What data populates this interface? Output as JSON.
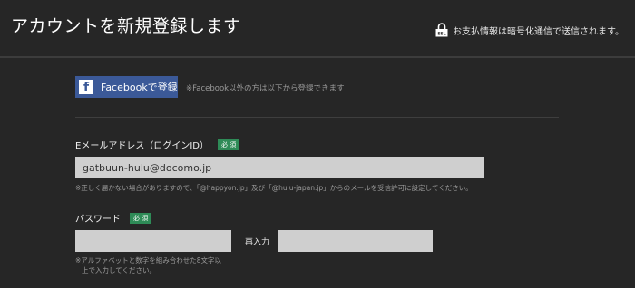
{
  "header": {
    "title": "アカウントを新規登録します",
    "secure_note": "お支払情報は暗号化通信で送信されます。",
    "secure_icon": "ssl-lock-icon"
  },
  "facebook": {
    "button_label": "Facebookで登録",
    "logo_letter": "f",
    "note": "※Facebook以外の方は以下から登録できます",
    "brand_color": "#3b5998"
  },
  "email": {
    "label": "Eメールアドレス（ログインID）",
    "required": "必 須",
    "value": "gatbuun-hulu@docomo.jp",
    "note": "※正しく届かない場合がありますので、「@happyon.jp」及び「@hulu-japan.jp」からのメールを受信許可に設定してください。"
  },
  "password": {
    "label": "パスワード",
    "required": "必 須",
    "value": "",
    "reenter_label": "再入力",
    "reenter_value": "",
    "note_line1": "※アルファベットと数字を組み合わせた8文字以",
    "note_line2": "上で入力してください。"
  },
  "colors": {
    "background": "#262626",
    "required_badge": "#2e8b57",
    "input_bg": "#cfcfcf"
  }
}
